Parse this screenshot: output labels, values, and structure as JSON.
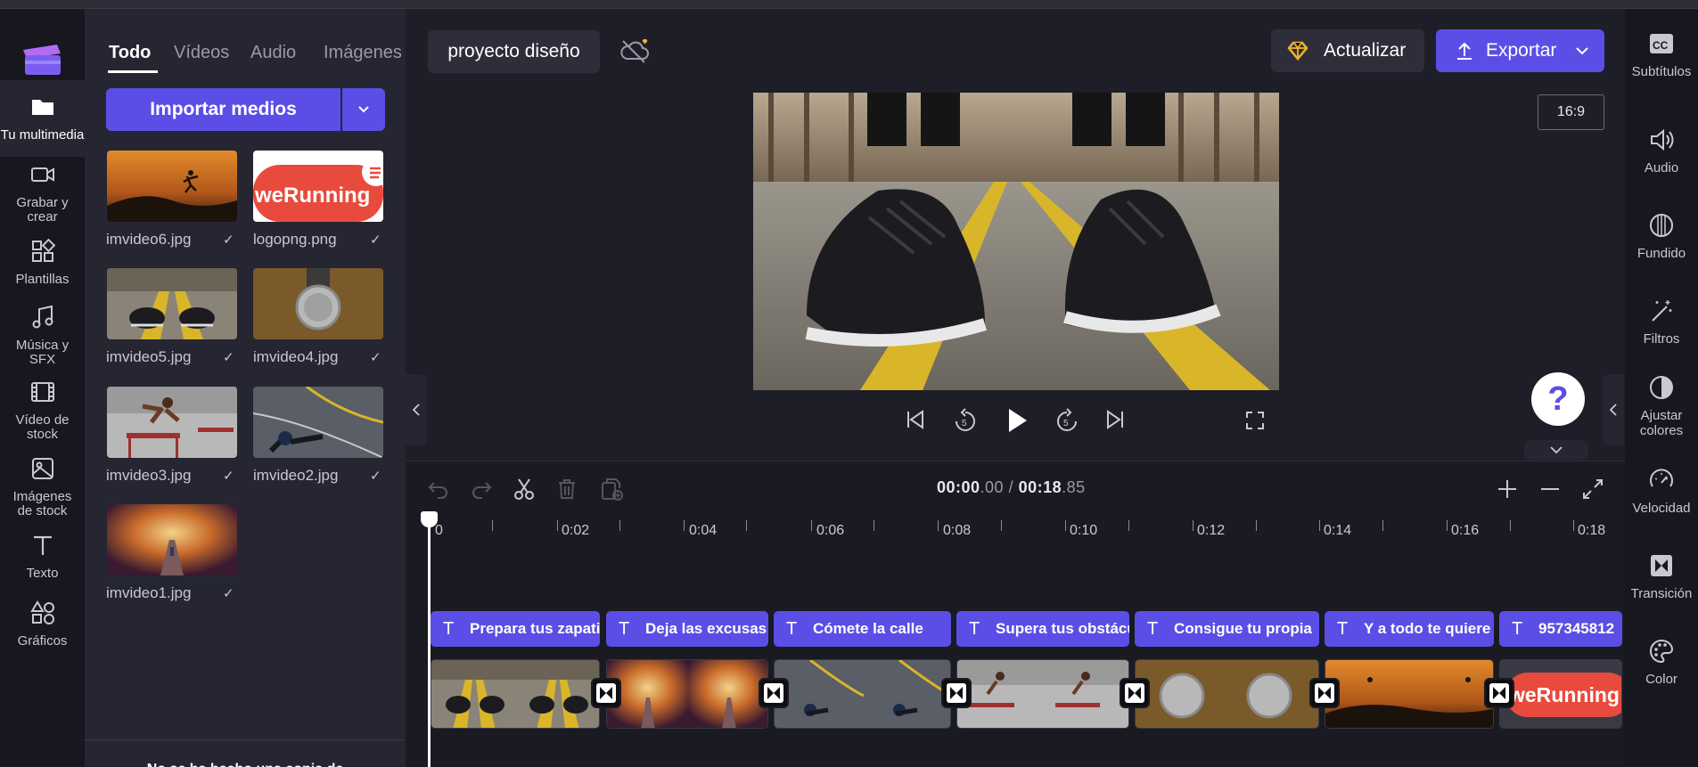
{
  "app": {
    "name": "Clipchamp"
  },
  "leftnav": {
    "items": [
      {
        "label": "Tu multimedia",
        "icon": "folder-icon",
        "active": true
      },
      {
        "label": "Grabar y crear",
        "icon": "camera-icon"
      },
      {
        "label": "Plantillas",
        "icon": "templates-icon"
      },
      {
        "label": "Música y SFX",
        "icon": "music-icon"
      },
      {
        "label": "Vídeo de stock",
        "icon": "film-icon"
      },
      {
        "label": "Imágenes de stock",
        "icon": "image-icon"
      },
      {
        "label": "Texto",
        "icon": "text-icon"
      },
      {
        "label": "Gráficos",
        "icon": "shapes-icon"
      }
    ]
  },
  "media": {
    "tabs": [
      "Todo",
      "Vídeos",
      "Audio",
      "Imágenes"
    ],
    "active_tab": "Todo",
    "import_label": "Importar medios",
    "files": [
      {
        "name": "imvideo6.jpg"
      },
      {
        "name": "logopng.png"
      },
      {
        "name": "imvideo5.jpg"
      },
      {
        "name": "imvideo4.jpg"
      },
      {
        "name": "imvideo3.jpg"
      },
      {
        "name": "imvideo2.jpg"
      },
      {
        "name": "imvideo1.jpg"
      }
    ],
    "backup_note": "No se ha hecho una copia de"
  },
  "header": {
    "project_name": "proyecto diseño",
    "update_label": "Actualizar",
    "export_label": "Exportar",
    "aspect_ratio": "16:9"
  },
  "preview": {
    "help": "?"
  },
  "timeline": {
    "current": "00:00",
    "current_frac": ".00",
    "sep": " / ",
    "total": "00:18",
    "total_frac": ".85",
    "ticks": [
      "0",
      "0:02",
      "0:04",
      "0:06",
      "0:08",
      "0:10",
      "0:12",
      "0:14",
      "0:16",
      "0:18"
    ],
    "text_clips": [
      "Prepara tus zapati",
      "Deja las excusas",
      "Cómete la calle",
      "Supera tus obstácu",
      "Consigue tu propia",
      "Y a todo te quiere",
      "957345812"
    ],
    "logo_text": "weRunning"
  },
  "rightpanel": {
    "items": [
      {
        "label": "Subtítulos",
        "icon": "cc-icon"
      },
      {
        "label": "Audio",
        "icon": "speaker-icon"
      },
      {
        "label": "Fundido",
        "icon": "fade-icon"
      },
      {
        "label": "Filtros",
        "icon": "magic-wand-icon"
      },
      {
        "label": "Ajustar colores",
        "icon": "contrast-icon"
      },
      {
        "label": "Velocidad",
        "icon": "speedometer-icon"
      },
      {
        "label": "Transición",
        "icon": "transition-icon"
      },
      {
        "label": "Color",
        "icon": "palette-icon"
      }
    ]
  },
  "colors": {
    "accent": "#5b4ee6",
    "panel": "#262632",
    "background": "#1e1e28"
  }
}
